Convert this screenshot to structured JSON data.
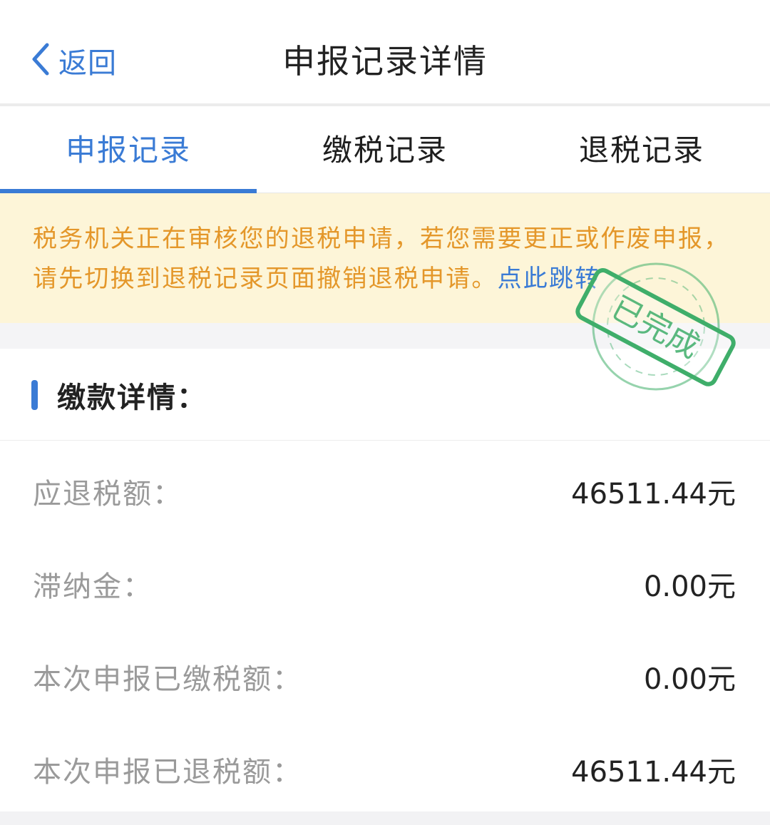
{
  "navbar": {
    "back_label": "返回",
    "title": "申报记录详情"
  },
  "tabs": [
    {
      "label": "申报记录",
      "active": true
    },
    {
      "label": "缴税记录",
      "active": false
    },
    {
      "label": "退税记录",
      "active": false
    }
  ],
  "notice": {
    "text": "税务机关正在审核您的退税申请，若您需要更正或作废申报，请先切换到退税记录页面撤销退税申请。",
    "link": "点此跳转"
  },
  "stamp": {
    "text": "已完成"
  },
  "section": {
    "title": "缴款详情："
  },
  "rows": [
    {
      "label": "应退税额：",
      "value": "46511.44元"
    },
    {
      "label": "滞纳金：",
      "value": "0.00元"
    },
    {
      "label": "本次申报已缴税额：",
      "value": "0.00元"
    },
    {
      "label": "本次申报已退税额：",
      "value": "46511.44元"
    }
  ],
  "colors": {
    "accent": "#3a7bd5",
    "notice_bg": "#fdf5d8",
    "notice_text": "#e4972a",
    "stamp": "#3fae6a"
  }
}
